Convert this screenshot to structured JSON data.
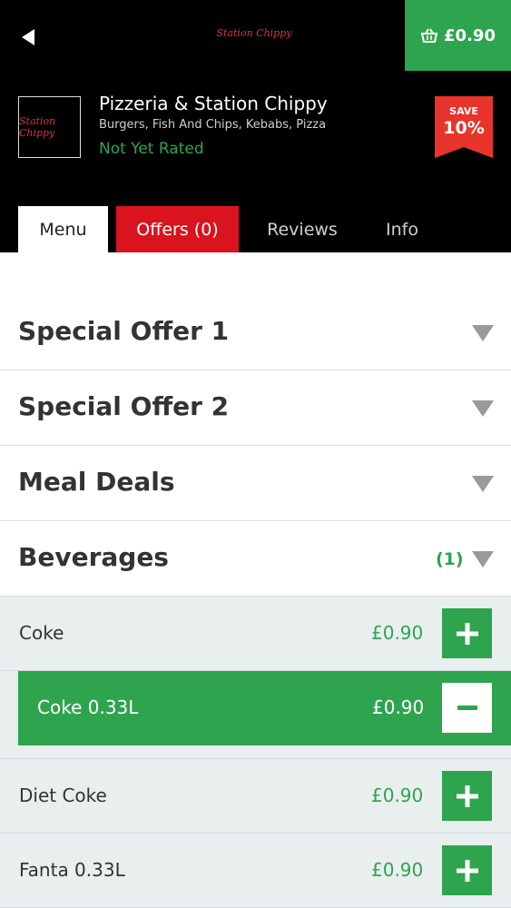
{
  "header": {
    "logo_text": "Station Chippy",
    "basket_total": "£0.90",
    "restaurant_name": "Pizzeria & Station Chippy",
    "categories": "Burgers, Fish And Chips, Kebabs, Pizza",
    "rating": "Not Yet Rated",
    "save_label": "SAVE",
    "save_percent": "10%"
  },
  "tabs": {
    "menu": "Menu",
    "offers": "Offers (0)",
    "reviews": "Reviews",
    "info": "Info"
  },
  "categories": [
    {
      "title": "Special Offer 1"
    },
    {
      "title": "Special Offer 2"
    },
    {
      "title": "Meal Deals"
    },
    {
      "title": "Beverages",
      "count": "(1)"
    }
  ],
  "items": [
    {
      "name": "Coke",
      "price": "£0.90"
    },
    {
      "name": "Diet Coke",
      "price": "£0.90"
    },
    {
      "name": "Fanta 0.33L",
      "price": "£0.90"
    }
  ],
  "selected_option": {
    "name": "Coke 0.33L",
    "price": "£0.90"
  },
  "colors": {
    "accent_green": "#2ea44f",
    "offers_red": "#d9141f",
    "header_bg": "#000000"
  }
}
